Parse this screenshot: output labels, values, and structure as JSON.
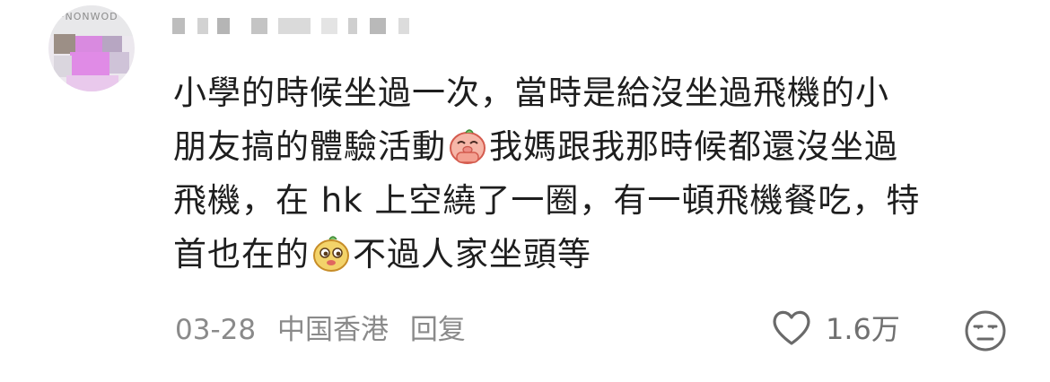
{
  "comment": {
    "lines": [
      "小學的時候坐過一次，當時是給沒坐過飛機的小",
      "朋友搞的體驗活動",
      "我媽跟我那時候都還沒坐過",
      "飛機，在 hk 上空繞了一圈，有一頓飛機餐吃，特",
      "首也在的",
      "不過人家坐頭等"
    ],
    "emoji_1": "pig-praying-emoji",
    "emoji_2": "smug-potato-emoji"
  },
  "meta": {
    "date": "03-28",
    "location": "中国香港",
    "reply_label": "回复"
  },
  "actions": {
    "like_icon": "heart-outline-icon",
    "like_count": "1.6万",
    "dislike_icon": "unamused-face-icon"
  },
  "colors": {
    "text": "#1e1e1e",
    "meta": "#8a8a8a",
    "icon": "#707070"
  }
}
